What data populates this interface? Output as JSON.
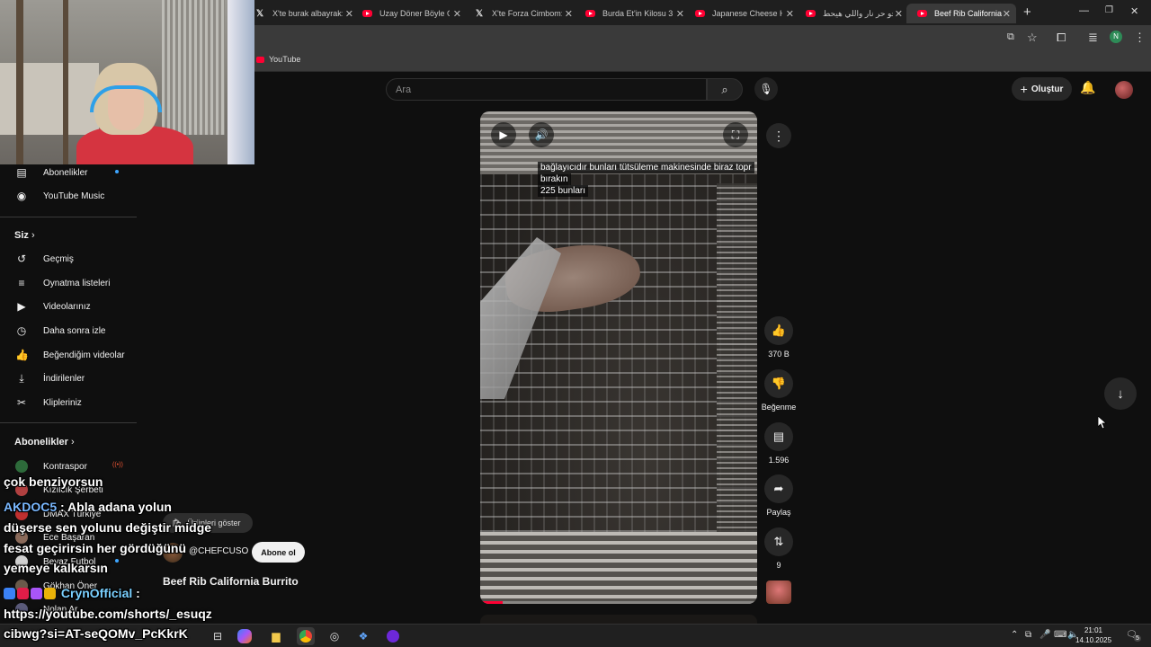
{
  "browser": {
    "tabs": [
      {
        "favicon": "x-icon",
        "title": "X'te burak albayrak: \""
      },
      {
        "favicon": "youtube-icon",
        "title": "Uzay Döner Böyle Ol"
      },
      {
        "favicon": "x-icon",
        "title": "X'te Forza Cimbom: \""
      },
      {
        "favicon": "youtube-icon",
        "title": "Burda Et'in Kilosu 39"
      },
      {
        "favicon": "youtube-icon",
        "title": "Japanese Cheese Han"
      },
      {
        "favicon": "youtube-icon",
        "title": "الجو حر نار واللي هيحط"
      },
      {
        "favicon": "youtube-icon",
        "title": "Beef Rib California Bu",
        "active": true
      }
    ],
    "new_tab": "+",
    "bookmark": "YouTube",
    "profile_initial": "N"
  },
  "youtube": {
    "search_placeholder": "Ara",
    "create_label": "Oluştur",
    "sidebar": {
      "top_items": [
        {
          "icon": "subscriptions-icon",
          "label": "Abonelikler"
        },
        {
          "icon": "youtube-music-icon",
          "label": "YouTube Music"
        }
      ],
      "you_heading": "Siz",
      "you_items": [
        {
          "icon": "history-icon",
          "label": "Geçmiş"
        },
        {
          "icon": "playlists-icon",
          "label": "Oynatma listeleri"
        },
        {
          "icon": "your-videos-icon",
          "label": "Videolarınız"
        },
        {
          "icon": "watch-later-icon",
          "label": "Daha sonra izle"
        },
        {
          "icon": "liked-videos-icon",
          "label": "Beğendiğim videolar"
        },
        {
          "icon": "downloads-icon",
          "label": "İndirilenler"
        },
        {
          "icon": "clips-icon",
          "label": "Klipleriniz"
        }
      ],
      "subs_heading": "Abonelikler",
      "subscriptions": [
        {
          "name": "Kontraspor",
          "live": true,
          "color": "#2d6a3a"
        },
        {
          "name": "Kızılcık Şerbeti",
          "live": false,
          "color": "#b04040"
        },
        {
          "name": "DMAX Türkiye",
          "live": false,
          "color": "#c03030"
        },
        {
          "name": "Ece Başaran",
          "live": false,
          "color": "#8a6a5a"
        },
        {
          "name": "Beyaz Futbol",
          "live": true,
          "color": "#d0d0d0"
        },
        {
          "name": "Gökhan Öner",
          "live": false,
          "color": "#6a5a4a"
        },
        {
          "name": "Nolan Ar",
          "live": false,
          "color": "#5a5a7a"
        }
      ]
    },
    "video": {
      "caption_line1": "bağlayıcıdır bunları tütsüleme makinesinde biraz topr",
      "caption_line2": "bırakın",
      "caption_line3": "225 bunları",
      "progress_fraction": 0.08
    },
    "actions": [
      {
        "icon": "like-icon",
        "label": "370 B"
      },
      {
        "icon": "dislike-icon",
        "label": "Beğenme"
      },
      {
        "icon": "comments-icon",
        "label": "1.596"
      },
      {
        "icon": "share-icon",
        "label": "Paylaş"
      },
      {
        "icon": "remix-icon",
        "label": "9"
      }
    ],
    "show_products": "Ürünleri göster",
    "channel": "@CHEFCUSO",
    "subscribe": "Abone ol",
    "short_title": "Beef Rib California Burrito"
  },
  "chat_overlay": {
    "messages": [
      {
        "text": "çok benziyorsun"
      },
      {
        "user": "AKDOC5",
        "text": ": Abla adana yolun"
      },
      {
        "text": "düşerse sen yolunu değiştir midge"
      },
      {
        "text": "fesat geçirirsin her gördüğünü"
      },
      {
        "text": "yemeye kalkarsın"
      },
      {
        "user": "CrynOfficial",
        "text": " :"
      },
      {
        "text": "https://youtube.com/shorts/_esuqz"
      },
      {
        "text": "cibwg?si=AT-seQOMv_PcKkrK"
      }
    ]
  },
  "taskbar": {
    "time": "21:01",
    "date": "14.10.2025",
    "notifications": "5"
  }
}
